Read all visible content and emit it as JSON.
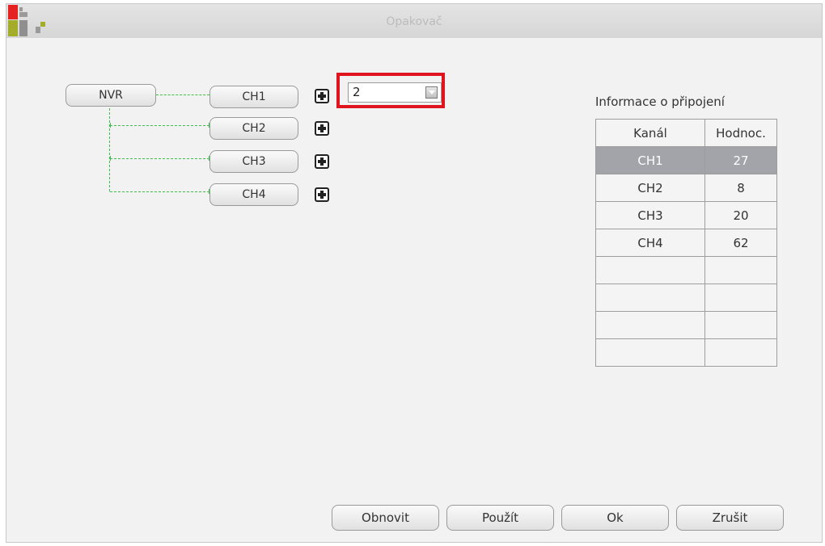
{
  "window": {
    "title": "Opakovač"
  },
  "topology": {
    "root_label": "NVR",
    "channels": [
      {
        "label": "CH1"
      },
      {
        "label": "CH2"
      },
      {
        "label": "CH3"
      },
      {
        "label": "CH4"
      }
    ],
    "repeater_select": {
      "value": "2"
    }
  },
  "info": {
    "title": "Informace o připojení",
    "headers": [
      "Kanál",
      "Hodnoc."
    ],
    "rows": [
      [
        "CH1",
        "27"
      ],
      [
        "CH2",
        "8"
      ],
      [
        "CH3",
        "20"
      ],
      [
        "CH4",
        "62"
      ],
      [
        "",
        ""
      ],
      [
        "",
        ""
      ],
      [
        "",
        ""
      ],
      [
        "",
        ""
      ]
    ],
    "selected_row": 0
  },
  "footer": {
    "refresh_label": "Obnovit",
    "apply_label": "Použít",
    "ok_label": "Ok",
    "cancel_label": "Zrušit"
  },
  "colors": {
    "highlight": "#e0141e",
    "link_line": "#3cc24a",
    "selected_row": "#a3a3aa"
  },
  "icons": [
    "app-logo-icon",
    "plus-icon",
    "chevron-down-icon"
  ]
}
